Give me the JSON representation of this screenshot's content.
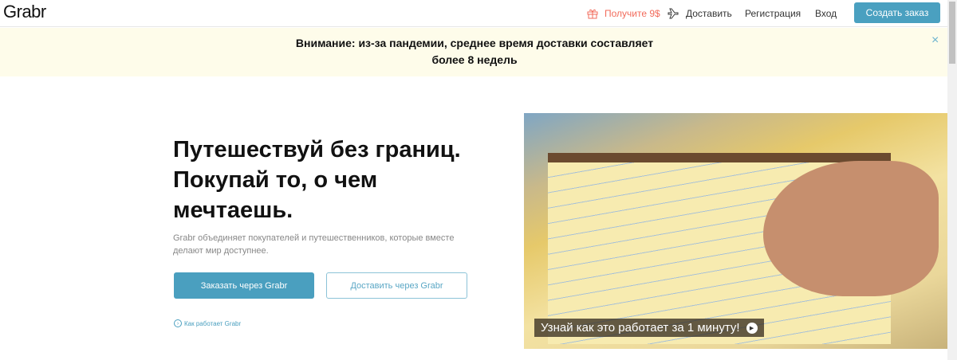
{
  "header": {
    "logo": "Grabr",
    "promo": "Получите 9$",
    "deliver": "Доставить",
    "register": "Регистрация",
    "login": "Вход",
    "create_order": "Создать заказ"
  },
  "banner": {
    "text": "Внимание: из-за пандемии, среднее время доставки составляет более 8 недель",
    "close_icon": "×"
  },
  "hero": {
    "title": "Путешествуй без границ. Покупай то, о чем мечтаешь.",
    "description": "Grabr объединяет покупателей и путешественников, которые вместе делают мир доступнее.",
    "order_button": "Заказать через Grabr",
    "deliver_button": "Доставить через Grabr",
    "how_link": "Как работает Grabr"
  },
  "video": {
    "caption": "Узнай как это работает за 1 минуту!"
  },
  "colors": {
    "accent": "#4a9fbf",
    "promo": "#f26b5b",
    "banner_bg": "#fefcea"
  }
}
